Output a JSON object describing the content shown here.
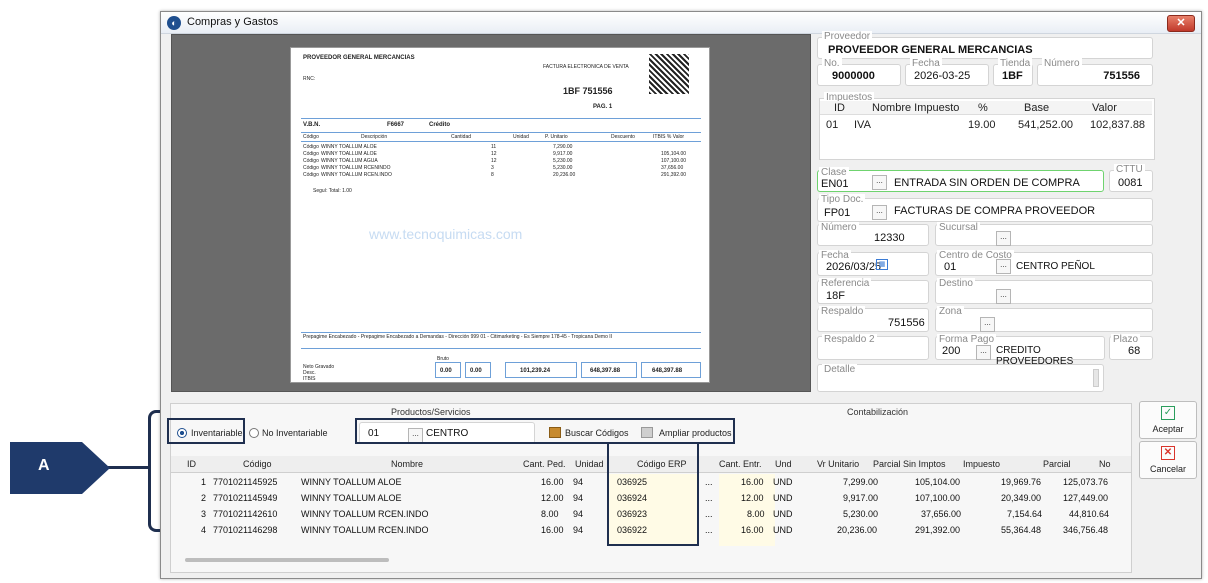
{
  "window": {
    "title": "Compras y Gastos"
  },
  "close_symbol": "✕",
  "document": {
    "vendor": "PROVEEDOR GENERAL MERCANCIAS",
    "doc_label": "FACTURA ELECTRONICA DE VENTA",
    "invoice": "1BF 751556",
    "rnc": "RNC:",
    "pag": "PAG. 1",
    "vbn": "V.B.N.",
    "code": "F6667",
    "credit": "Crédito",
    "col_code": "Código",
    "col_desc": "Descripción",
    "col_qty": "Cantidad",
    "col_unit": "Unidad",
    "col_price": "P. Unitario",
    "col_disc": "Descuento",
    "col_total": "ITBIS % Valor",
    "lines": [
      {
        "code": "Código",
        "desc": "WINNY TOALLUM ALOE",
        "qty": "11",
        "price": "7,290.00",
        "total": ""
      },
      {
        "code": "Código",
        "desc": "WINNY TOALLUM ALOE",
        "qty": "12",
        "price": "9,917.00",
        "total": "105,104.00"
      },
      {
        "code": "Código",
        "desc": "WINNY TOALLUM AGUA",
        "qty": "12",
        "price": "5,230.00",
        "total": "107,100.00"
      },
      {
        "code": "Código",
        "desc": "WINNY TOALLUM RCENINDO",
        "qty": "3",
        "price": "5,230.00",
        "total": "37,656.00"
      },
      {
        "code": "Código",
        "desc": "WINNY TOALLUM RCEN.INDO",
        "qty": "8",
        "price": "20,236.00",
        "total": "291,392.00"
      }
    ],
    "total_line": "Seguí: Total: 1.00",
    "watermark": "www.tecnoquimicas.com",
    "footer_text": "Prepagime Encabezado - Prepagime Encabezado a Demandas - Dirección 999 01 - Citimarketing - Es Siempre 178-45 - Tropicana Demo II",
    "sub_label": "Bruto",
    "sub1": "0.00",
    "sub2": "0.00",
    "total_fiscal": "101,239.24",
    "total_factura": "648,397.88",
    "total_factura2": "648,397.88",
    "bottom_labels": [
      "Neto Gravado",
      "Desc.",
      "ITBIS"
    ]
  },
  "proveedor": {
    "label": "Proveedor",
    "value": "PROVEEDOR GENERAL MERCANCIAS"
  },
  "no": {
    "label": "No.",
    "value": "9000000"
  },
  "fecha_top": {
    "label": "Fecha",
    "value": "2026-03-25"
  },
  "tienda": {
    "label": "Tienda",
    "value": "1BF"
  },
  "numero_top": {
    "label": "Número",
    "value": "751556"
  },
  "impuestos": {
    "label": "Impuestos",
    "headers": [
      "ID",
      "Nombre Impuesto",
      "%",
      "Base",
      "Valor"
    ],
    "row": [
      "01",
      "IVA",
      "19.00",
      "541,252.00",
      "102,837.88"
    ]
  },
  "clase": {
    "label": "Clase",
    "code": "EN01",
    "value": "ENTRADA SIN ORDEN DE COMPRA"
  },
  "cttu": {
    "label": "CTTU",
    "value": "0081"
  },
  "tipo_doc": {
    "label": "Tipo Doc.",
    "code": "FP01",
    "value": "FACTURAS DE COMPRA PROVEEDOR"
  },
  "numero": {
    "label": "Número",
    "value": "12330"
  },
  "sucursal": {
    "label": "Sucursal"
  },
  "fecha": {
    "label": "Fecha",
    "value": "2026/03/25"
  },
  "centro_costo": {
    "label": "Centro de Costo",
    "code": "01",
    "value": "CENTRO PEÑOL"
  },
  "referencia": {
    "label": "Referencia",
    "value": "18F"
  },
  "destino": {
    "label": "Destino"
  },
  "respaldo": {
    "label": "Respaldo",
    "value": "751556"
  },
  "zona": {
    "label": "Zona"
  },
  "respaldo2": {
    "label": "Respaldo 2"
  },
  "forma_pago": {
    "label": "Forma Pago",
    "code": "200",
    "value": "CREDITO PROVEEDORES"
  },
  "plazo": {
    "label": "Plazo",
    "value": "68"
  },
  "detalle": {
    "label": "Detalle"
  },
  "ellipsis": "...",
  "productos": {
    "section": "Productos/Servicios",
    "contab": "Contabilización",
    "inventariable": "Inventariable",
    "no_inventariable": "No Inventariable",
    "centro_code": "01",
    "centro_value": "CENTRO",
    "buscar": "Buscar Códigos",
    "ampliar": "Ampliar productos",
    "headers": [
      "ID",
      "Código",
      "Nombre",
      "Cant. Ped.",
      "Unidad",
      "Código ERP",
      "Cant. Entr.",
      "Und",
      "Vr Unitario",
      "Parcial Sin Imptos",
      "Impuesto",
      "Parcial",
      "No"
    ],
    "rows": [
      {
        "id": "1",
        "codigo": "7701021145925",
        "nombre": "WINNY TOALLUM ALOE",
        "cant": "16.00",
        "unidad": "94",
        "erp": "036925",
        "entr": "16.00",
        "und": "UND",
        "vr": "7,299.00",
        "parcial_sin": "105,104.00",
        "impuesto": "19,969.76",
        "parcial": "125,073.76"
      },
      {
        "id": "2",
        "codigo": "7701021145949",
        "nombre": "WINNY TOALLUM ALOE",
        "cant": "12.00",
        "unidad": "94",
        "erp": "036924",
        "entr": "12.00",
        "und": "UND",
        "vr": "9,917.00",
        "parcial_sin": "107,100.00",
        "impuesto": "20,349.00",
        "parcial": "127,449.00"
      },
      {
        "id": "3",
        "codigo": "7701021142610",
        "nombre": "WINNY TOALLUM RCEN.INDO",
        "cant": "8.00",
        "unidad": "94",
        "erp": "036923",
        "entr": "8.00",
        "und": "UND",
        "vr": "5,230.00",
        "parcial_sin": "37,656.00",
        "impuesto": "7,154.64",
        "parcial": "44,810.64"
      },
      {
        "id": "4",
        "codigo": "7701021146298",
        "nombre": "WINNY TOALLUM RCEN.INDO",
        "cant": "16.00",
        "unidad": "94",
        "erp": "036922",
        "entr": "16.00",
        "und": "UND",
        "vr": "20,236.00",
        "parcial_sin": "291,392.00",
        "impuesto": "55,364.48",
        "parcial": "346,756.48"
      }
    ]
  },
  "aceptar": "Aceptar",
  "cancelar": "Cancelar",
  "callout": "A",
  "colors": {
    "accent": "#1f4f8f",
    "annotation": "#1f2f4f",
    "erp_bg": "#fffbe6",
    "check_green": "#2a9d5c",
    "cancel_red": "#d9342b"
  }
}
